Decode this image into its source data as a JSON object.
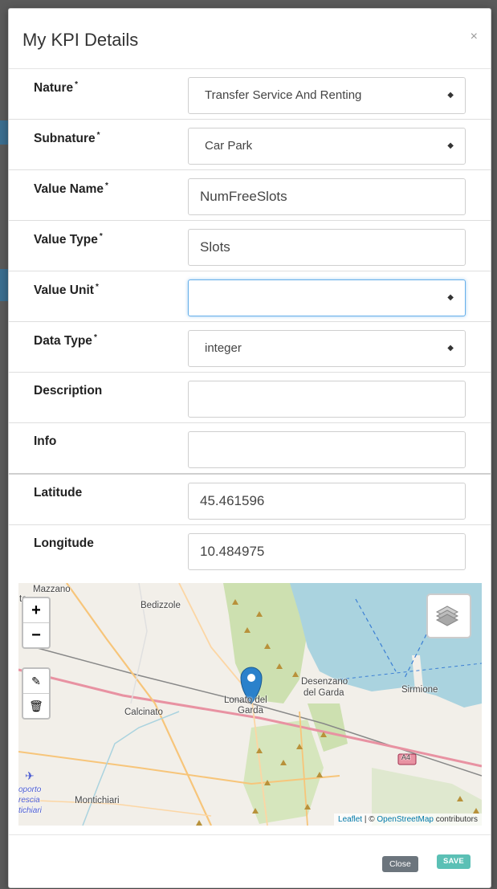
{
  "modal": {
    "title": "My KPI Details",
    "close_glyph": "×"
  },
  "form": {
    "nature": {
      "label": "Nature",
      "required": "*",
      "value": "Transfer Service And Renting"
    },
    "subnature": {
      "label": "Subnature",
      "required": "*",
      "value": "Car Park"
    },
    "value_name": {
      "label": "Value Name",
      "required": "*",
      "value": "NumFreeSlots"
    },
    "value_type": {
      "label": "Value Type",
      "required": "*",
      "value": "Slots"
    },
    "value_unit": {
      "label": "Value Unit",
      "required": "*",
      "value": ""
    },
    "data_type": {
      "label": "Data Type",
      "required": "*",
      "value": "integer"
    },
    "description": {
      "label": "Description",
      "value": ""
    },
    "info": {
      "label": "Info",
      "value": ""
    },
    "latitude": {
      "label": "Latitude",
      "value": "45.461596"
    },
    "longitude": {
      "label": "Longitude",
      "value": "10.484975"
    }
  },
  "map": {
    "zoom_in": "+",
    "zoom_out": "−",
    "edit_glyph": "✎",
    "delete_glyph": "🗑",
    "labels": {
      "mazzano": "Mazzano",
      "bedizzole": "Bedizzole",
      "calcinato": "Calcinato",
      "lonato_1": "Lonato del",
      "lonato_2": "Garda",
      "desenzano_1": "Desenzano",
      "desenzano_2": "del Garda",
      "sirmione": "Sirmione",
      "montichiari": "Montichiari",
      "road_a4": "A4",
      "aeroporto_1": "oporto",
      "aeroporto_2": "rescia",
      "aeroporto_3": "tichiari",
      "edge_to": "to"
    },
    "attribution": {
      "leaflet": "Leaflet",
      "sep": " | © ",
      "osm": "OpenStreetMap",
      "suffix": " contributors"
    },
    "colors": {
      "lake": "#aad3df",
      "motorway": "#e892a2",
      "road": "#f7c57a",
      "forest": "#cde0b0",
      "marker": "#2a81cb"
    }
  },
  "footer": {
    "close_label": "Close",
    "save_label": "SAVE"
  }
}
